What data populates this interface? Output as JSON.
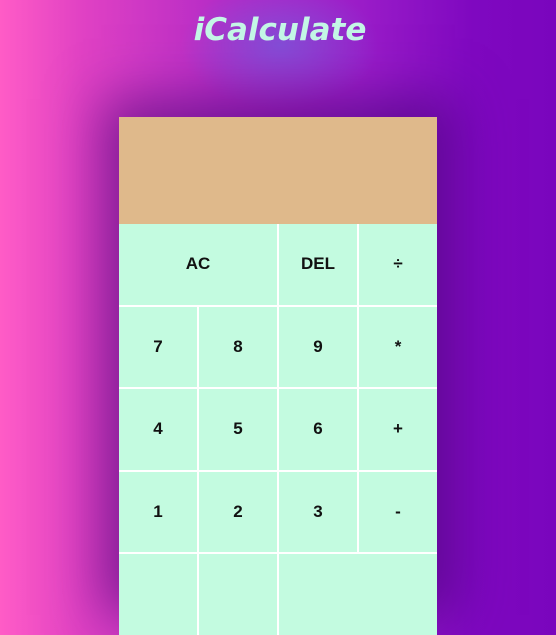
{
  "title": "iCalculate",
  "display": {
    "value": ""
  },
  "buttons": [
    "AC",
    "DEL",
    "÷",
    "7",
    "8",
    "9",
    "*",
    "4",
    "5",
    "6",
    "+",
    "1",
    "2",
    "3",
    "-",
    "",
    "",
    ""
  ],
  "colors": {
    "display": "#dfb98b",
    "button": "#c3fbe0",
    "title": "#c4f7e6"
  }
}
